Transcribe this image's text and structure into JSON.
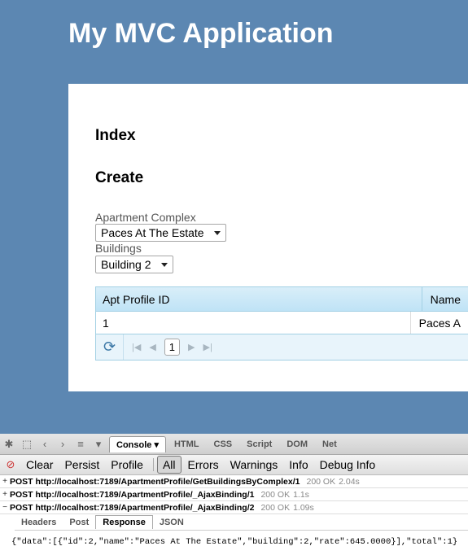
{
  "site": {
    "title": "My MVC Application"
  },
  "page": {
    "heading_index": "Index",
    "heading_create": "Create",
    "apartment_label": "Apartment Complex",
    "apartment_value": "Paces At The Estate",
    "buildings_label": "Buildings",
    "buildings_value": "Building 2"
  },
  "grid": {
    "columns": [
      "Apt Profile ID",
      "Name"
    ],
    "rows": [
      {
        "id": "1",
        "name": "Paces A"
      }
    ],
    "pager": {
      "current_page": "1"
    }
  },
  "firebug": {
    "tabs": [
      "Console",
      "HTML",
      "CSS",
      "Script",
      "DOM",
      "Net"
    ],
    "toolbar": [
      "Clear",
      "Persist",
      "Profile",
      "All",
      "Errors",
      "Warnings",
      "Info",
      "Debug Info"
    ],
    "requests": [
      {
        "toggle": "+",
        "url": "POST http://localhost:7189/ApartmentProfile/GetBuildingsByComplex/1",
        "status": "200 OK",
        "time": "2.04s"
      },
      {
        "toggle": "+",
        "url": "POST http://localhost:7189/ApartmentProfile/_AjaxBinding/1",
        "status": "200 OK",
        "time": "1.1s"
      },
      {
        "toggle": "−",
        "url": "POST http://localhost:7189/ApartmentProfile/_AjaxBinding/2",
        "status": "200 OK",
        "time": "1.09s"
      }
    ],
    "detail_tabs": [
      "Headers",
      "Post",
      "Response",
      "JSON"
    ],
    "response": "{\"data\":[{\"id\":2,\"name\":\"Paces At The Estate\",\"building\":2,\"rate\":645.0000}],\"total\":1}"
  }
}
